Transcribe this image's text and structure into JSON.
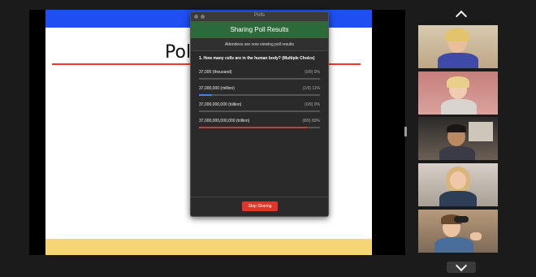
{
  "slide": {
    "title": "Poll",
    "colors": {
      "top_bar": "#1f4ef2",
      "underline": "#e63a2e",
      "footer": "#f6d574"
    }
  },
  "poll_window": {
    "title": "Polls",
    "banner": "Sharing Poll Results",
    "subheading": "Attendees are now viewing poll results",
    "question": "1. How many cells are in the human body? (Multiple Choice)",
    "answers": [
      {
        "label": "37,000 (thousand)",
        "stat": "(0/9) 0%",
        "percent": 0,
        "color": "#6aa0ff"
      },
      {
        "label": "37,000,000 (million)",
        "stat": "(1/9) 11%",
        "percent": 11,
        "color": "#3b82f6"
      },
      {
        "label": "37,000,000,000 (billion)",
        "stat": "(0/9) 0%",
        "percent": 0,
        "color": "#6aa0ff"
      },
      {
        "label": "37,000,000,000,000 (trillion)",
        "stat": "(8/9) 89%",
        "percent": 89,
        "color": "#e0362a"
      }
    ],
    "stop_button": "Stop Sharing"
  },
  "gallery": {
    "nav_up_icon": "chevron-up-icon",
    "nav_down_icon": "chevron-down-icon",
    "participants": [
      {
        "name": "participant-1"
      },
      {
        "name": "participant-2"
      },
      {
        "name": "participant-3"
      },
      {
        "name": "participant-4"
      },
      {
        "name": "participant-5"
      }
    ]
  }
}
